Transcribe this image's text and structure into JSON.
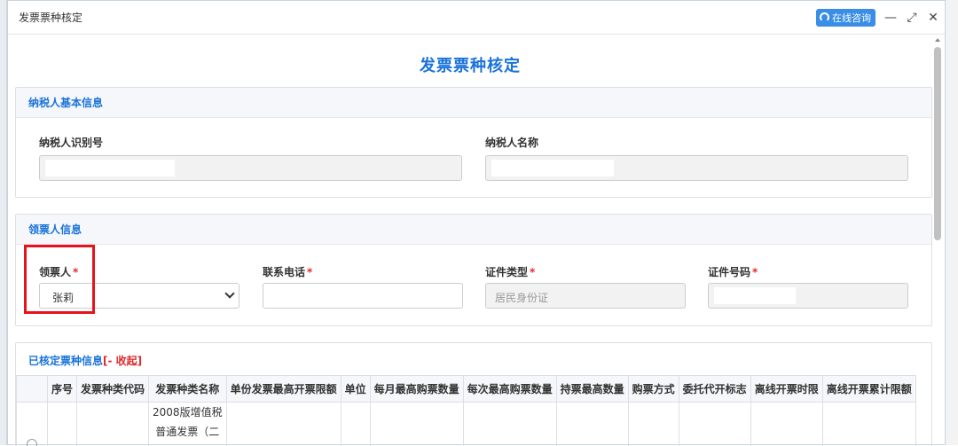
{
  "dialog": {
    "title": "发票票种核定",
    "consult_label": "在线咨询"
  },
  "main_title": "发票票种核定",
  "taxpayer": {
    "section_title": "纳税人基本信息",
    "id_label": "纳税人识别号",
    "name_label": "纳税人名称"
  },
  "receiver": {
    "section_title": "领票人信息",
    "person_label": "领票人",
    "person_value": "张莉",
    "phone_label": "联系电话",
    "cert_type_label": "证件类型",
    "cert_type_value": "居民身份证",
    "cert_no_label": "证件号码"
  },
  "approved": {
    "section_title": "已核定票种信息",
    "collapse_label": "[- 收起]",
    "columns": [
      "序号",
      "发票种类代码",
      "发票种类名称",
      "单份发票最高开票限额",
      "单位",
      "每月最高购票数量",
      "每次最高购票数量",
      "持票最高数量",
      "购票方式",
      "委托代开标志",
      "离线开票时限",
      "离线开票累计限额"
    ],
    "row": {
      "name_line1": "2008版增值税",
      "name_line2": "普通发票（二"
    }
  },
  "colors": {
    "accent": "#1a73d9",
    "required": "#e0292a",
    "highlight_box": "#e8121a"
  }
}
